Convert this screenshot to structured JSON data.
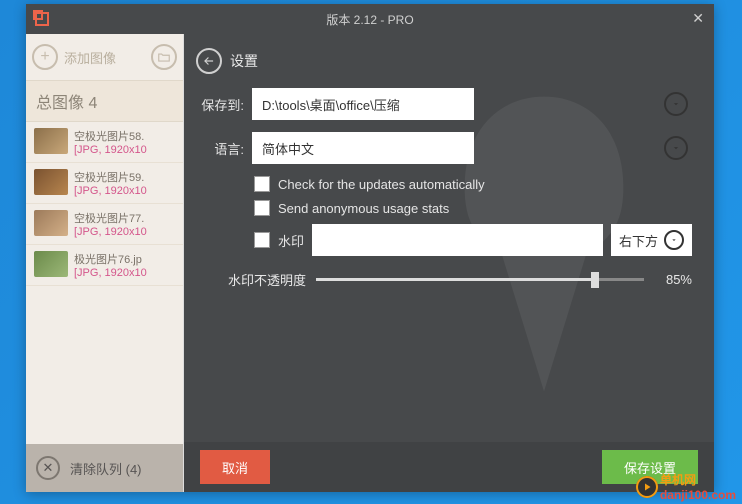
{
  "window": {
    "title": "版本 2.12 - PRO"
  },
  "sidebar": {
    "add_label": "添加图像",
    "total_label": "总图像 4",
    "files": [
      {
        "name": "空极光图片58.",
        "meta": "[JPG, 1920x10"
      },
      {
        "name": "空极光图片59.",
        "meta": "[JPG, 1920x10"
      },
      {
        "name": "空极光图片77.",
        "meta": "[JPG, 1920x10"
      },
      {
        "name": "极光图片76.jp",
        "meta": "[JPG, 1920x10"
      }
    ],
    "clear_label": "清除队列 (4)"
  },
  "settings": {
    "title": "设置",
    "save_to_label": "保存到:",
    "save_to_value": "D:\\tools\\桌面\\office\\压缩",
    "language_label": "语言:",
    "language_value": "简体中文",
    "check_updates": "Check for the updates automatically",
    "send_stats": "Send anonymous usage stats",
    "watermark_label": "水印",
    "watermark_pos": "右下方",
    "opacity_label": "水印不透明度",
    "opacity_value": "85%",
    "opacity_pct": 85
  },
  "footer": {
    "cancel": "取消",
    "save": "保存设置"
  },
  "brand": {
    "a": "单机网",
    "b": "danji100.com"
  }
}
